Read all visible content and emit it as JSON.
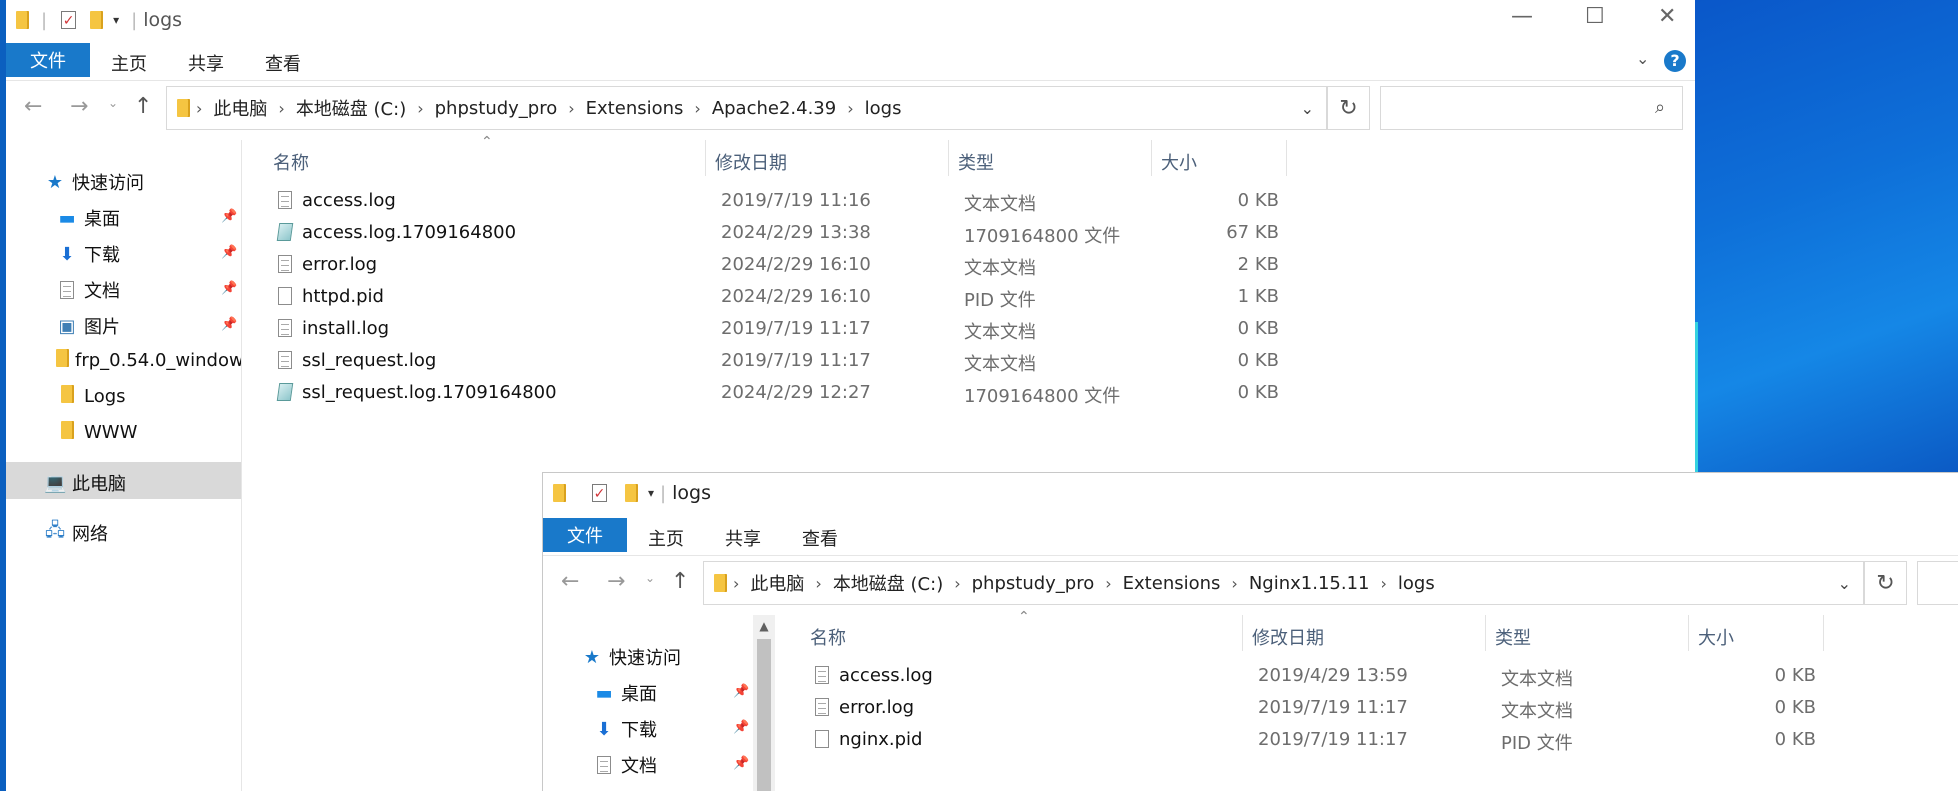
{
  "w1": {
    "title": "logs",
    "ribbon": {
      "file": "文件",
      "tabs": [
        "主页",
        "共享",
        "查看"
      ]
    },
    "address": [
      "此电脑",
      "本地磁盘 (C:)",
      "phpstudy_pro",
      "Extensions",
      "Apache2.4.39",
      "logs"
    ],
    "nav": [
      {
        "label": "快速访问",
        "icon": "star-icon"
      },
      {
        "label": "桌面",
        "icon": "desktop-icon",
        "pinned": true
      },
      {
        "label": "下载",
        "icon": "download-icon",
        "pinned": true
      },
      {
        "label": "文档",
        "icon": "document-icon",
        "pinned": true
      },
      {
        "label": "图片",
        "icon": "pictures-icon",
        "pinned": true
      },
      {
        "label": "frp_0.54.0_window",
        "icon": "folder-icon"
      },
      {
        "label": "Logs",
        "icon": "folder-icon"
      },
      {
        "label": "WWW",
        "icon": "folder-icon"
      },
      {
        "label": "此电脑",
        "icon": "computer-icon",
        "selected": true
      },
      {
        "label": "网络",
        "icon": "network-icon"
      }
    ],
    "columns": [
      "名称",
      "修改日期",
      "类型",
      "大小"
    ],
    "files": [
      {
        "name": "access.log",
        "date": "2019/7/19 11:16",
        "type": "文本文档",
        "size": "0 KB",
        "icon": "text"
      },
      {
        "name": "access.log.1709164800",
        "date": "2024/2/29 13:38",
        "type": "1709164800 文件",
        "size": "67 KB",
        "icon": "special"
      },
      {
        "name": "error.log",
        "date": "2024/2/29 16:10",
        "type": "文本文档",
        "size": "2 KB",
        "icon": "text"
      },
      {
        "name": "httpd.pid",
        "date": "2024/2/29 16:10",
        "type": "PID 文件",
        "size": "1 KB",
        "icon": "plain"
      },
      {
        "name": "install.log",
        "date": "2019/7/19 11:17",
        "type": "文本文档",
        "size": "0 KB",
        "icon": "text"
      },
      {
        "name": "ssl_request.log",
        "date": "2019/7/19 11:17",
        "type": "文本文档",
        "size": "0 KB",
        "icon": "text"
      },
      {
        "name": "ssl_request.log.1709164800",
        "date": "2024/2/29 12:27",
        "type": "1709164800 文件",
        "size": "0 KB",
        "icon": "special"
      }
    ]
  },
  "w2": {
    "title": "logs",
    "ribbon": {
      "file": "文件",
      "tabs": [
        "主页",
        "共享",
        "查看"
      ]
    },
    "address": [
      "此电脑",
      "本地磁盘 (C:)",
      "phpstudy_pro",
      "Extensions",
      "Nginx1.15.11",
      "logs"
    ],
    "nav": [
      {
        "label": "快速访问",
        "icon": "star-icon"
      },
      {
        "label": "桌面",
        "icon": "desktop-icon",
        "pinned": true
      },
      {
        "label": "下载",
        "icon": "download-icon",
        "pinned": true
      },
      {
        "label": "文档",
        "icon": "document-icon",
        "pinned": true
      }
    ],
    "columns": [
      "名称",
      "修改日期",
      "类型",
      "大小"
    ],
    "files": [
      {
        "name": "access.log",
        "date": "2019/4/29 13:59",
        "type": "文本文档",
        "size": "0 KB",
        "icon": "text"
      },
      {
        "name": "error.log",
        "date": "2019/7/19 11:17",
        "type": "文本文档",
        "size": "0 KB",
        "icon": "text"
      },
      {
        "name": "nginx.pid",
        "date": "2019/7/19 11:17",
        "type": "PID 文件",
        "size": "0 KB",
        "icon": "plain"
      }
    ]
  },
  "colors": {
    "accent": "#1979ca",
    "selected": "#d9d9d9",
    "desktop": "#0b5fbf",
    "header_text": "#4c607a"
  }
}
